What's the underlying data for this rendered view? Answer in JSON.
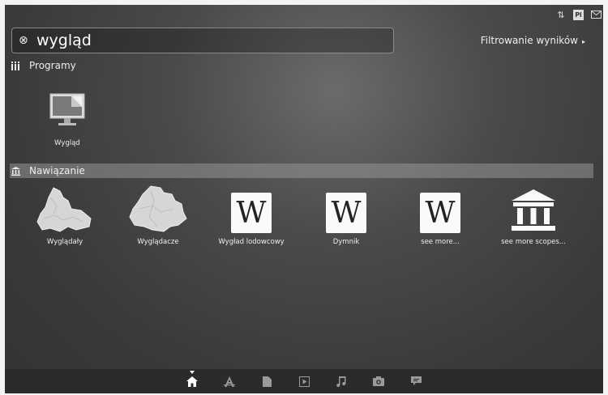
{
  "search": {
    "query": "wygląd"
  },
  "filter": {
    "label": "Filtrowanie wyników"
  },
  "categories": {
    "programs": {
      "title": "Programy",
      "items": [
        {
          "label": "Wygląd",
          "icon": "display-settings-icon"
        }
      ]
    },
    "related": {
      "title": "Nawiązanie",
      "items": [
        {
          "label": "Wyglądały",
          "icon": "map-region-icon"
        },
        {
          "label": "Wyglądacze",
          "icon": "map-region-icon"
        },
        {
          "label": "Wygład lodowcowy",
          "icon": "wikipedia-icon"
        },
        {
          "label": "Dymnik",
          "icon": "wikipedia-icon"
        },
        {
          "label": "see more...",
          "icon": "wikipedia-icon"
        },
        {
          "label": "see more scopes...",
          "icon": "scopes-building-icon"
        }
      ]
    }
  },
  "wiki_glyph": "W",
  "colors": {
    "dash_bg": "#3a3a3a",
    "active_header": "#8e8e8e",
    "text": "#eeeeee"
  }
}
